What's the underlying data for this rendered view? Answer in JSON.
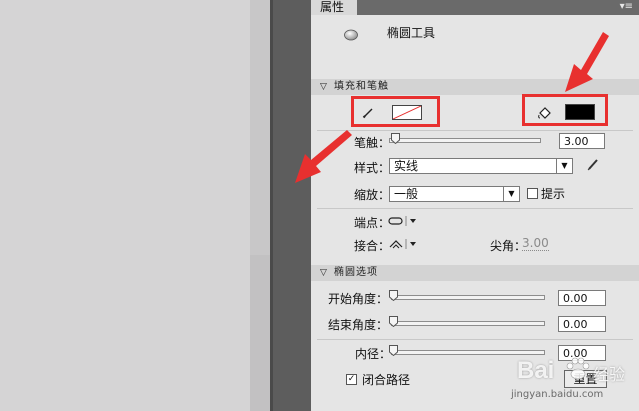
{
  "panel": {
    "tab_label": "属性",
    "menu_icon": "panel-menu-icon",
    "tool_name": "椭圆工具",
    "tool_icon": "oval-tool-icon"
  },
  "fill_stroke": {
    "header": "填充和笔触",
    "stroke_color": "none",
    "fill_color": "#000000",
    "stroke_label": "笔触：",
    "stroke_value": "3.00",
    "style_label": "样式：",
    "style_value": "实线",
    "scale_label": "缩放：",
    "scale_value": "一般",
    "hint_label": "提示",
    "hint_checked": false,
    "cap_label": "端点：",
    "join_label": "接合：",
    "miter_label": "尖角：",
    "miter_value": "3.00"
  },
  "oval_options": {
    "header": "椭圆选项",
    "start_angle_label": "开始角度：",
    "start_angle_value": "0.00",
    "end_angle_label": "结束角度：",
    "end_angle_value": "0.00",
    "inner_radius_label": "内径：",
    "inner_radius_value": "0.00",
    "close_path_label": "闭合路径",
    "close_path_checked": true,
    "reset_label": "重置"
  },
  "watermark": {
    "brand": "Bai",
    "brand2": "经验",
    "url": "jingyan.baidu.com"
  },
  "colors": {
    "annotation_red": "#e8302f",
    "panel_bg": "#e5e5e5"
  }
}
